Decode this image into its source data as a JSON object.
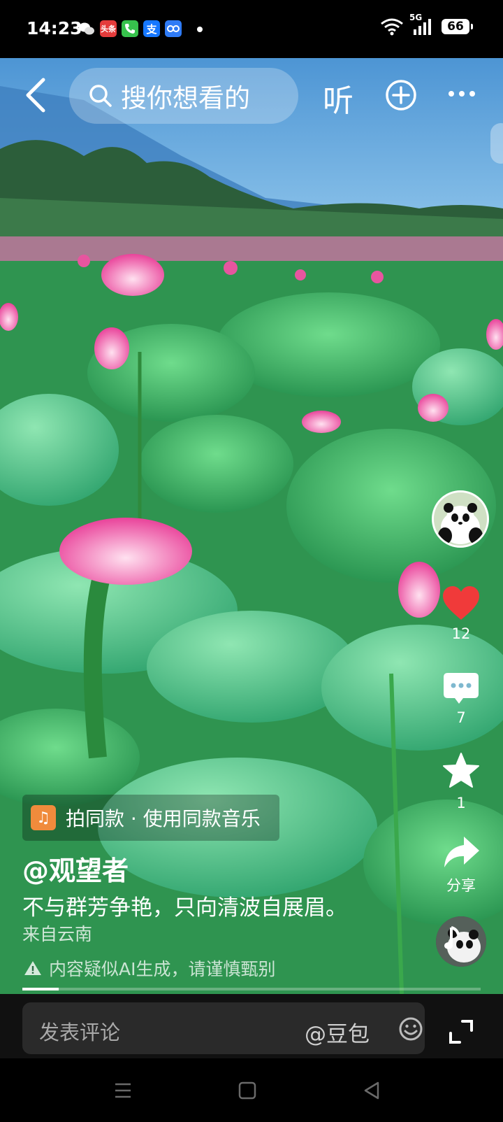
{
  "status_bar": {
    "time": "14:23",
    "app_icons": [
      {
        "name": "wechat-icon",
        "color": "#ffffff"
      },
      {
        "name": "toutiao-icon",
        "label": "头条",
        "color": "#e43b3b"
      },
      {
        "name": "phone-icon",
        "color": "#37c24c"
      },
      {
        "name": "alipay-icon",
        "label": "支",
        "color": "#1677ff"
      },
      {
        "name": "baidu-netdisk-icon",
        "color": "#2f7bf6"
      }
    ],
    "network": "5G",
    "battery": "66"
  },
  "top_bar": {
    "search_placeholder": "搜你想看的",
    "listen_label": "听"
  },
  "actions": {
    "like_count": "12",
    "comment_count": "7",
    "favorite_count": "1",
    "share_label": "分享",
    "like_color": "#f03a3a"
  },
  "post": {
    "music_label": "拍同款 · 使用同款音乐",
    "author": "@观望者",
    "caption": "不与群芳争艳，只向清波自展眉。",
    "location": "来自云南",
    "ai_notice": "内容疑似AI生成，请谨慎甄别",
    "progress": 0.08
  },
  "comment_bar": {
    "placeholder": "发表评论",
    "mention": "@豆包"
  }
}
